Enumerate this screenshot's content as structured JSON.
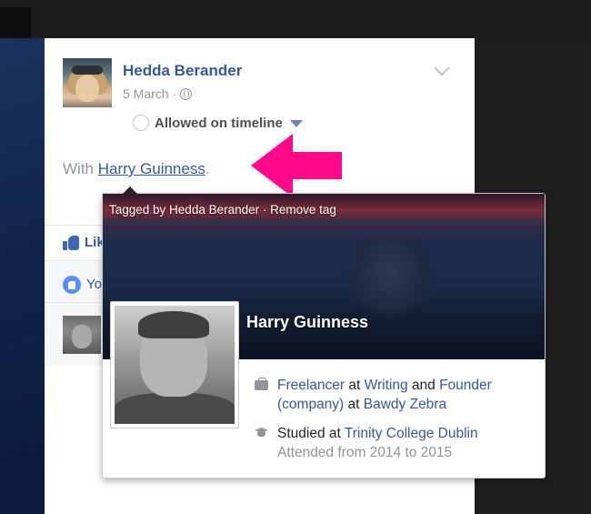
{
  "post": {
    "author": "Hedda Berander",
    "date": "5 March",
    "separator": "·",
    "audience_icon": "globe-icon",
    "timeline_status": "Allowed on timeline",
    "with_prefix": "With ",
    "tagged_name": "Harry Guinness",
    "with_suffix": ".",
    "like_label": "Lik",
    "reaction_text": "Yo"
  },
  "hovercard": {
    "tagged_by": "Tagged by Hedda Berander · Remove tag",
    "name": "Harry Guinness",
    "work": {
      "role1": "Freelancer",
      "at1": " at ",
      "org1": "Writing",
      "and": " and ",
      "role2": "Founder",
      "role2_suffix": "(company)",
      "at2": " at ",
      "org2": "Bawdy Zebra"
    },
    "education": {
      "studied_at": "Studied at ",
      "school": "Trinity College Dublin",
      "attended": "Attended from 2014 to 2015"
    }
  },
  "colors": {
    "link": "#365899",
    "annotation_arrow": "#ff0a8a"
  },
  "annotation": {
    "arrow_icon": "left-arrow-icon"
  }
}
